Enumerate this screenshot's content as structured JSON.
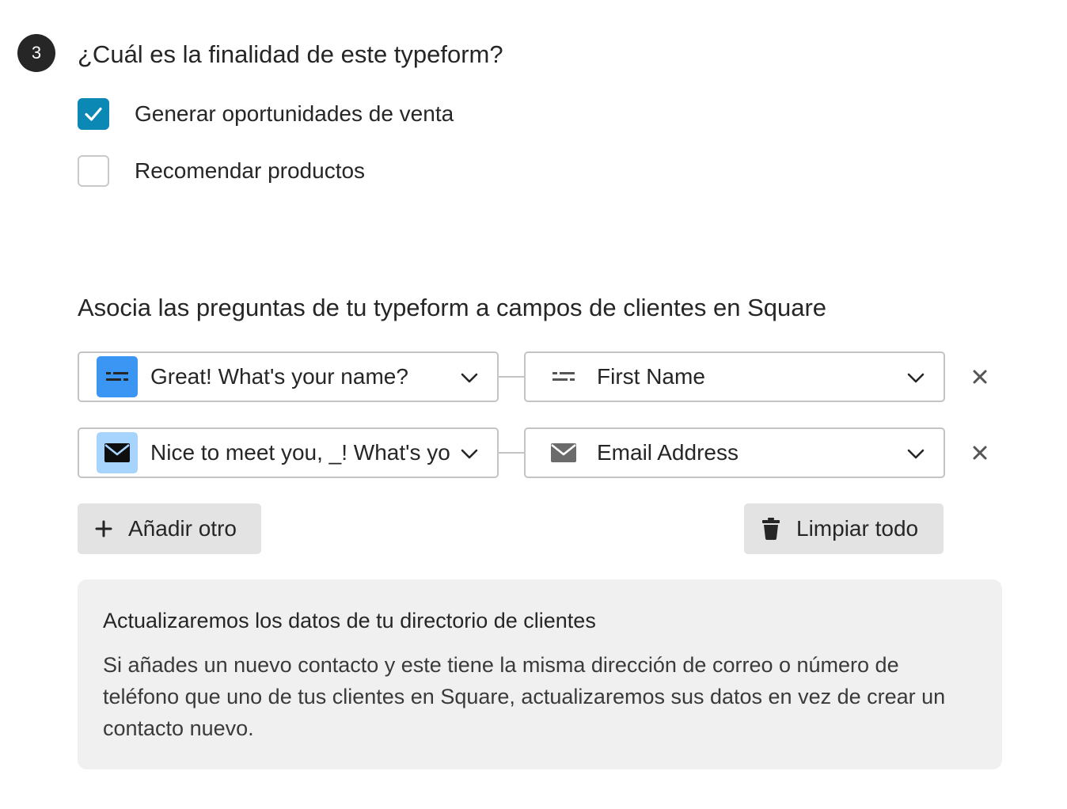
{
  "step": {
    "number": "3",
    "question": "¿Cuál es la finalidad de este typeform?"
  },
  "options": [
    {
      "label": "Generar oportunidades de venta",
      "checked": true
    },
    {
      "label": "Recomendar productos",
      "checked": false
    }
  ],
  "mapping": {
    "title": "Asocia las preguntas de tu typeform a campos de clientes en Square",
    "rows": [
      {
        "question": "Great! What's your name?",
        "question_icon": "short-text-icon",
        "field": "First Name",
        "field_icon": "short-text-icon"
      },
      {
        "question": "Nice to meet you, _! What's your email address?",
        "question_icon": "envelope-icon",
        "field": "Email Address",
        "field_icon": "envelope-icon"
      }
    ],
    "add_label": "Añadir otro",
    "clear_label": "Limpiar todo"
  },
  "info": {
    "title": "Actualizaremos los datos de tu directorio de clientes",
    "body": "Si añades un nuevo contacto y este tiene la misma dirección de correo o número de teléfono que uno de tus clientes en Square, actualizaremos sus datos en vez de crear un contacto nuevo."
  },
  "colors": {
    "checkbox_checked": "#0b88b4",
    "short_text_icon_bg": "#3b95f2",
    "email_icon_bg": "#a7d4fc",
    "button_bg": "#e3e3e3",
    "info_bg": "#f0f0f0"
  }
}
